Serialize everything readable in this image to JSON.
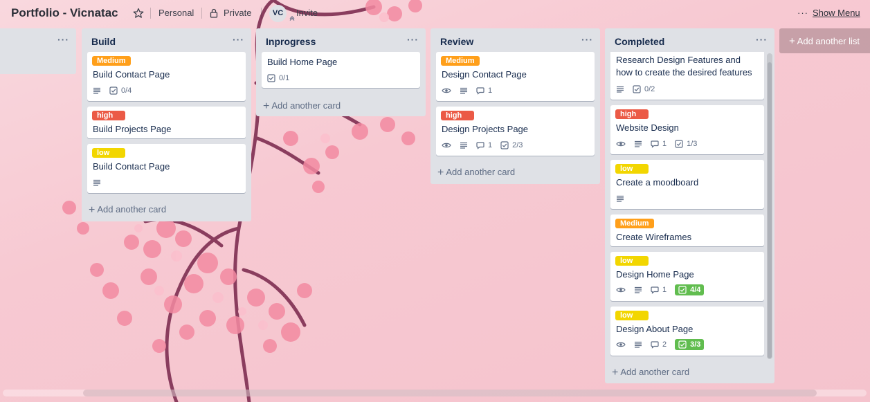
{
  "header": {
    "board_title": "Portfolio - Vicnatac",
    "team": "Personal",
    "visibility": "Private",
    "avatar_initials": "VC",
    "invite": "Invite",
    "show_menu": "Show Menu"
  },
  "lists": [
    {
      "title": "Build",
      "cards": [
        {
          "label": "Medium",
          "label_color": "#ff9f1a",
          "title": "Build Contact Page",
          "checklist": "0/4"
        },
        {
          "label": "high",
          "label_color": "#eb5a46",
          "title": "Build Projects Page"
        },
        {
          "label": "low",
          "label_color": "#f2d600",
          "title": "Build Contact Page"
        }
      ],
      "add_card": "Add another card"
    },
    {
      "title": "Inprogress",
      "cards": [
        {
          "title": "Build Home Page",
          "checklist": "0/1"
        }
      ],
      "add_card": "Add another card"
    },
    {
      "title": "Review",
      "cards": [
        {
          "label": "Medium",
          "label_color": "#ff9f1a",
          "title": "Design Contact Page",
          "comments": "1"
        },
        {
          "label": "high",
          "label_color": "#eb5a46",
          "title": "Design Projects Page",
          "comments": "1",
          "checklist": "2/3"
        }
      ],
      "add_card": "Add another card"
    },
    {
      "title": "Completed",
      "cards": [
        {
          "title": "Research Design Features and how to create the desired features",
          "checklist": "0/2"
        },
        {
          "label": "high",
          "label_color": "#eb5a46",
          "title": "Website Design",
          "comments": "1",
          "checklist": "1/3"
        },
        {
          "label": "low",
          "label_color": "#f2d600",
          "title": "Create a moodboard"
        },
        {
          "label": "Medium",
          "label_color": "#ff9f1a",
          "title": "Create Wireframes"
        },
        {
          "label": "low",
          "label_color": "#f2d600",
          "title": "Design Home Page",
          "comments": "1",
          "checklist": "4/4"
        },
        {
          "label": "low",
          "label_color": "#f2d600",
          "title": "Design About Page",
          "comments": "2",
          "checklist": "3/3"
        }
      ],
      "add_card": "Add another card"
    }
  ],
  "add_list": "Add another list",
  "colors": {
    "checklist_complete": "#61bd4f",
    "list_bg": "#dfe1e6"
  },
  "icons": [
    "star-icon",
    "lock-icon",
    "eye-icon",
    "description-icon",
    "comment-icon",
    "checklist-icon",
    "plus-icon",
    "menu-dots-icon"
  ]
}
